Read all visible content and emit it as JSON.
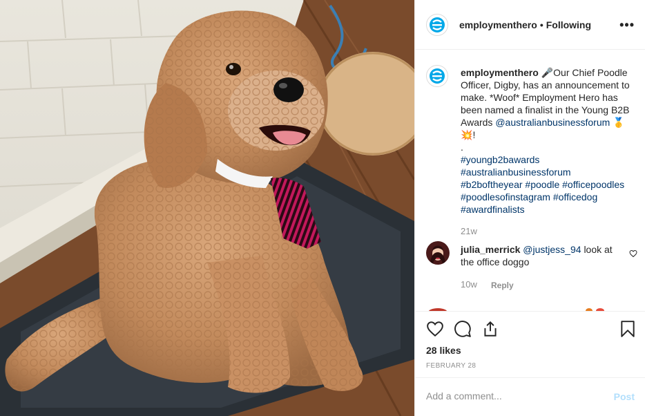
{
  "post": {
    "username": "employmenthero",
    "follow_status": "Following",
    "separator": "•",
    "more_label": "•••"
  },
  "caption": {
    "username": "employmenthero",
    "mic_emoji": "🎤",
    "text": "Our Chief Poodle Officer, Digby, has an announcement to make. *Woof* Employment Hero has been named a finalist in the Young B2B Awards",
    "mention": "@australianbusinessforum",
    "medal_emoji": "🥇",
    "boom_emoji": "💥",
    "exclaim": "!",
    "period_line": ".",
    "hashtags": [
      "#youngb2bawards",
      "#australianbusinessforum",
      "#b2boftheyear",
      "#poodle",
      "#officepoodles",
      "#poodlesofinstagram",
      "#officedog",
      "#awardfinalists"
    ],
    "time": "21w"
  },
  "comment": {
    "username": "julia_merrick",
    "mention": "@justjess_94",
    "text": "look at the office doggo",
    "time": "10w",
    "reply_label": "Reply"
  },
  "actions": {
    "likes": "28 likes",
    "date": "FEBRUARY 28"
  },
  "add_comment": {
    "placeholder": "Add a comment...",
    "post_label": "Post"
  },
  "colors": {
    "brand": "#00a8e8",
    "link": "#003569",
    "muted": "#8e8e8e",
    "post_disabled": "#b2dffc"
  },
  "icons": [
    "heart-icon",
    "comment-icon",
    "share-icon",
    "bookmark-icon",
    "more-icon",
    "like-comment-icon"
  ]
}
